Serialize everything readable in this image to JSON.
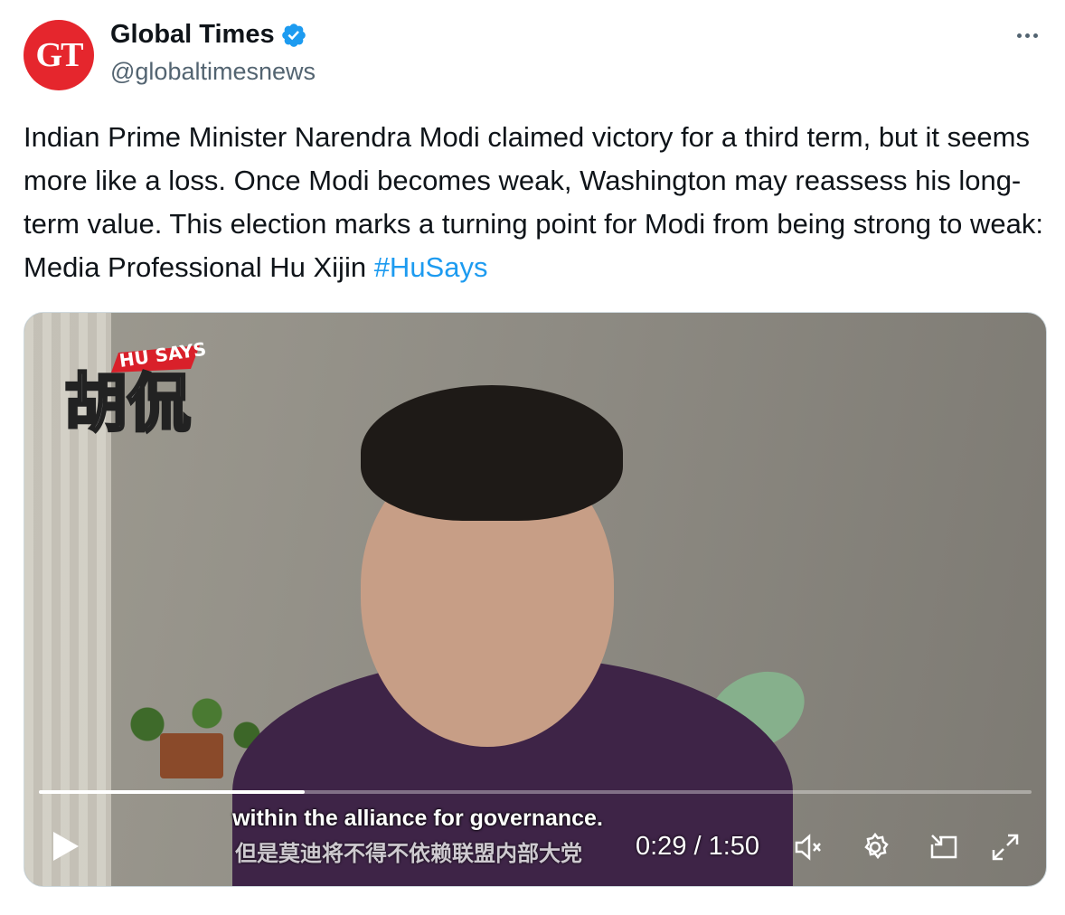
{
  "author": {
    "avatar_text": "GT",
    "display_name": "Global Times",
    "handle": "@globaltimesnews",
    "verified_icon": "verified-badge-icon"
  },
  "more_icon": "more-options-icon",
  "tweet": {
    "text": "Indian Prime Minister Narendra Modi claimed victory for a third term, but it seems more like a loss. Once Modi becomes weak, Washington may reassess his long-term value. This election marks a turning point for Modi from being strong to weak: Media Professional Hu Xijin ",
    "hashtag": "#HuSays"
  },
  "video": {
    "logo_text": "胡侃",
    "logo_sub_text": "HU SAYS",
    "subtitle_en": "within the alliance for governance.",
    "subtitle_zh": "但是莫迪将不得不依赖联盟内部大党",
    "time_label": "0:29 / 1:50",
    "progress_fraction": 0.268,
    "controls": {
      "play": "play-icon",
      "mute": "muted-speaker-icon",
      "settings": "settings-gear-icon",
      "pip": "picture-in-picture-icon",
      "fullscreen": "fullscreen-icon"
    }
  },
  "colors": {
    "link": "#1d9bf0",
    "avatar_bg": "#e5262d",
    "verified": "#1d9bf0",
    "secondary_text": "#536471"
  }
}
